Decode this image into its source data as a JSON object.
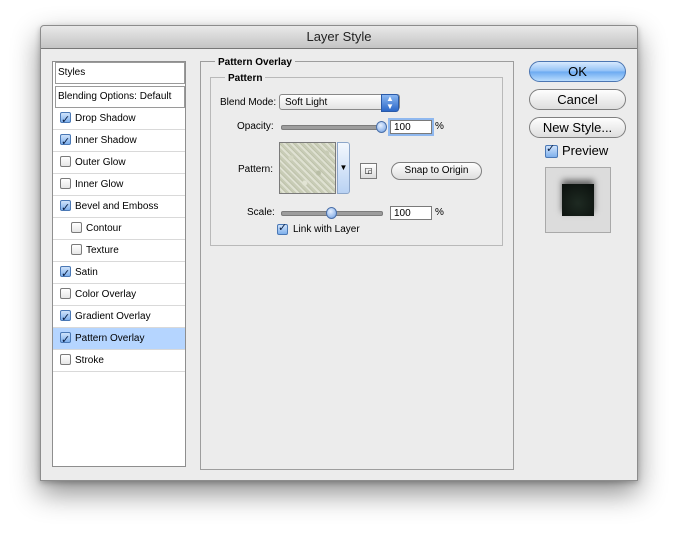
{
  "window": {
    "title": "Layer Style"
  },
  "sidebar": {
    "header": "Styles",
    "blending": "Blending Options: Default",
    "items": [
      {
        "label": "Drop Shadow",
        "checked": true,
        "indent": false,
        "selected": false
      },
      {
        "label": "Inner Shadow",
        "checked": true,
        "indent": false,
        "selected": false
      },
      {
        "label": "Outer Glow",
        "checked": false,
        "indent": false,
        "selected": false
      },
      {
        "label": "Inner Glow",
        "checked": false,
        "indent": false,
        "selected": false
      },
      {
        "label": "Bevel and Emboss",
        "checked": true,
        "indent": false,
        "selected": false
      },
      {
        "label": "Contour",
        "checked": false,
        "indent": true,
        "selected": false
      },
      {
        "label": "Texture",
        "checked": false,
        "indent": true,
        "selected": false
      },
      {
        "label": "Satin",
        "checked": true,
        "indent": false,
        "selected": false
      },
      {
        "label": "Color Overlay",
        "checked": false,
        "indent": false,
        "selected": false
      },
      {
        "label": "Gradient Overlay",
        "checked": true,
        "indent": false,
        "selected": false
      },
      {
        "label": "Pattern Overlay",
        "checked": true,
        "indent": false,
        "selected": true
      },
      {
        "label": "Stroke",
        "checked": false,
        "indent": false,
        "selected": false
      }
    ]
  },
  "panel": {
    "section_title": "Pattern Overlay",
    "group_title": "Pattern",
    "blend_mode_label": "Blend Mode:",
    "blend_mode_value": "Soft Light",
    "opacity_label": "Opacity:",
    "opacity_value": "100",
    "opacity_unit": "%",
    "opacity_fraction": 1.0,
    "pattern_label": "Pattern:",
    "snap_button": "Snap to Origin",
    "scale_label": "Scale:",
    "scale_value": "100",
    "scale_unit": "%",
    "scale_fraction": 0.5,
    "link_label": "Link with Layer",
    "link_checked": true
  },
  "buttons": {
    "ok": "OK",
    "cancel": "Cancel",
    "new_style": "New Style...",
    "preview_label": "Preview",
    "preview_checked": true
  },
  "colors": {
    "selection": "#b5d5ff",
    "accent": "#6aa9f1"
  }
}
